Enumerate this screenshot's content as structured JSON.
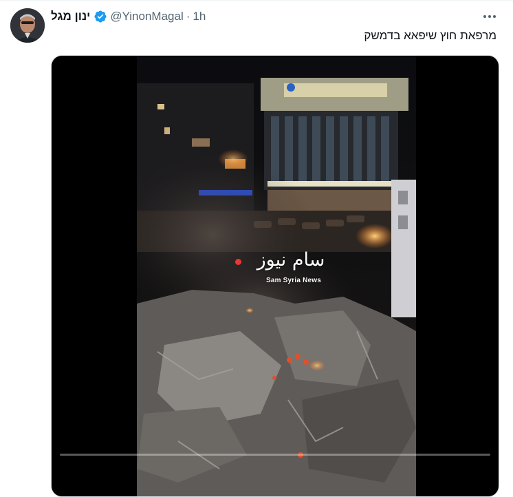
{
  "tweet": {
    "author_name": "ינון מגל",
    "handle": "@YinonMagal",
    "separator": "·",
    "time": "1h",
    "text": "מרפאת חוץ שיפאא בדמשק",
    "verified_color": "#1d9bf0",
    "more_icon": "more-horizontal-icon"
  },
  "media": {
    "watermark_arabic": "سام نيوز",
    "watermark_english": "Sam Syria News",
    "progress_fraction": 0.0
  }
}
